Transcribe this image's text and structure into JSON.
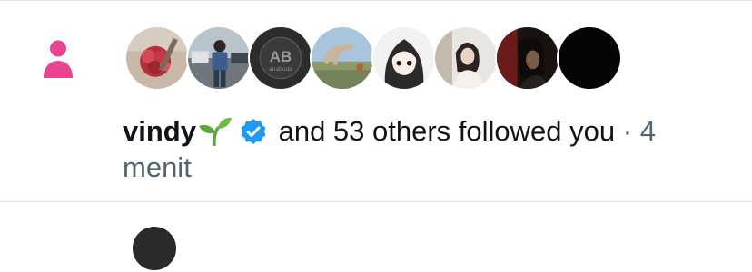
{
  "notification": {
    "icon": "person-icon",
    "icon_color": "#E8448F",
    "avatars": [
      {
        "name": "avatar-1",
        "depicts": "flowers"
      },
      {
        "name": "avatar-2",
        "depicts": "man-standing-street"
      },
      {
        "name": "avatar-3",
        "depicts": "AB-logo"
      },
      {
        "name": "avatar-4",
        "depicts": "dinosaur-landscape"
      },
      {
        "name": "avatar-5",
        "depicts": "anime-girl"
      },
      {
        "name": "avatar-6",
        "depicts": "woman-photo"
      },
      {
        "name": "avatar-7",
        "depicts": "dark-red-portrait"
      },
      {
        "name": "avatar-8",
        "depicts": "black"
      }
    ],
    "user_name": "vindy",
    "emoji": "seedling",
    "verified_color": "#1D9BF0",
    "message": "and 53 others followed you",
    "separator": "·",
    "time": "4 menit",
    "text_color": "#0F1419",
    "secondary_color": "#536471"
  }
}
